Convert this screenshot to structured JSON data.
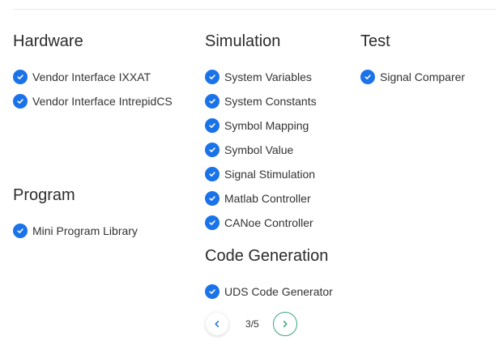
{
  "sections": {
    "hardware": {
      "title": "Hardware",
      "items": [
        "Vendor Interface IXXAT",
        "Vendor Interface IntrepidCS"
      ]
    },
    "simulation": {
      "title": "Simulation",
      "items": [
        "System Variables",
        "System Constants",
        "Symbol Mapping",
        "Symbol Value",
        "Signal Stimulation",
        "Matlab Controller",
        "CANoe Controller"
      ]
    },
    "test": {
      "title": "Test",
      "items": [
        "Signal Comparer"
      ]
    },
    "program": {
      "title": "Program",
      "items": [
        "Mini Program Library"
      ]
    },
    "code_generation": {
      "title": "Code Generation",
      "items": [
        "UDS Code Generator"
      ]
    }
  },
  "pagination": {
    "current": "3",
    "separator": "/",
    "total": "5",
    "prev_icon": "chevron-left-icon",
    "next_icon": "chevron-right-icon"
  },
  "colors": {
    "check_icon": "#1a73e8",
    "next_border": "#3aa57a",
    "prev_arrow": "#1a73e8",
    "next_arrow": "#3aa57a"
  }
}
